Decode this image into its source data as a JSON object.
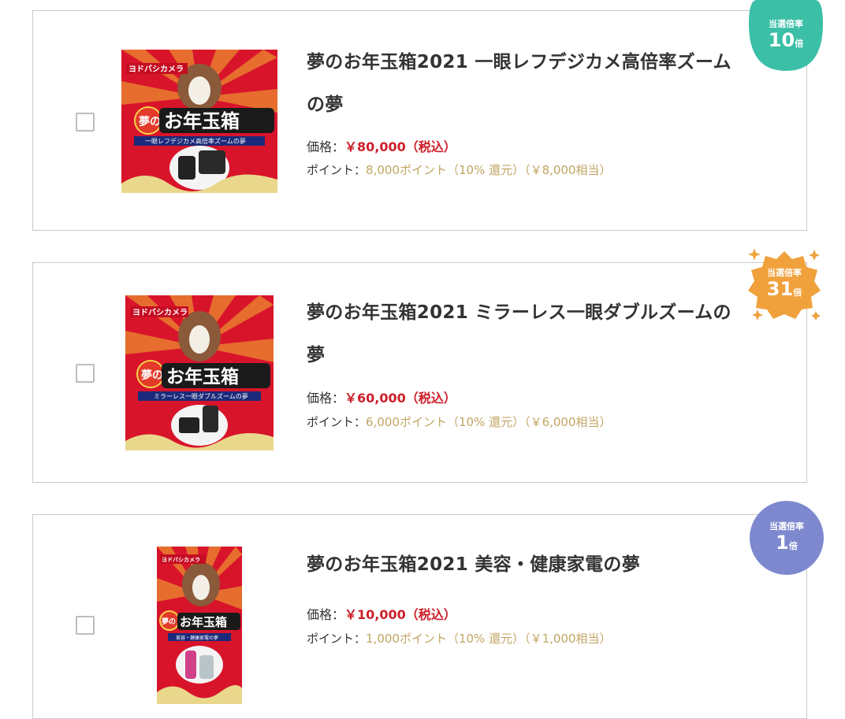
{
  "products": [
    {
      "title": "夢のお年玉箱2021 一眼レフデジカメ高倍率ズームの夢",
      "price_label": "価格：",
      "price_value": "￥80,000（税込）",
      "points_label": "ポイント：",
      "points_value": "8,000ポイント（10% 還元）（￥8,000相当）",
      "badge_label": "当選倍率",
      "badge_number": "10",
      "badge_unit": "倍",
      "badge_color": "#3bbfa6",
      "image": {
        "brand": "ヨドバシカメラ",
        "box_text": "お年玉箱",
        "yume": "夢の",
        "banner": "一眼レフデジカメ高倍率ズームの夢"
      }
    },
    {
      "title": "夢のお年玉箱2021 ミラーレス一眼ダブルズームの夢",
      "price_label": "価格：",
      "price_value": "￥60,000（税込）",
      "points_label": "ポイント：",
      "points_value": "6,000ポイント（10% 還元）（￥6,000相当）",
      "badge_label": "当選倍率",
      "badge_number": "31",
      "badge_unit": "倍",
      "badge_color": "#f0a13c",
      "image": {
        "brand": "ヨドバシカメラ",
        "box_text": "お年玉箱",
        "yume": "夢の",
        "banner": "ミラーレス一眼ダブルズームの夢"
      }
    },
    {
      "title": "夢のお年玉箱2021 美容・健康家電の夢",
      "price_label": "価格：",
      "price_value": "￥10,000（税込）",
      "points_label": "ポイント：",
      "points_value": "1,000ポイント（10% 還元）（￥1,000相当）",
      "badge_label": "当選倍率",
      "badge_number": "1",
      "badge_unit": "倍",
      "badge_color": "#7d88cf",
      "image": {
        "brand": "ヨドバシカメラ",
        "box_text": "お年玉箱",
        "yume": "夢の",
        "banner": "美容・健康家電の夢"
      }
    }
  ]
}
